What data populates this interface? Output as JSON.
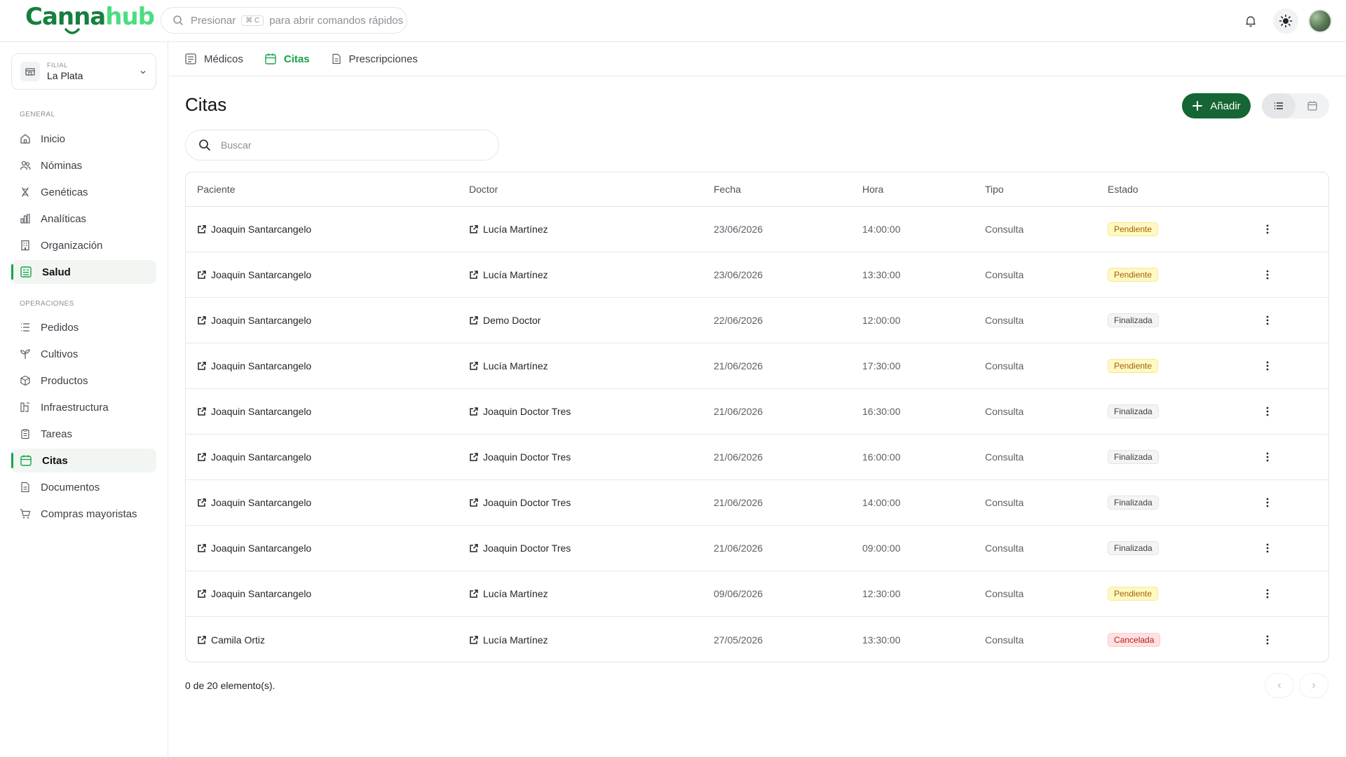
{
  "header": {
    "logo_part1": "Canna",
    "logo_part2": "hub",
    "command_prefix": "Presionar",
    "command_key": "⌘ C",
    "command_suffix": "para abrir comandos rápidos"
  },
  "sidebar": {
    "branch_caption": "FILIAL",
    "branch_name": "La Plata",
    "section_general": "GENERAL",
    "general_items": [
      {
        "label": "Inicio",
        "icon": "home-icon"
      },
      {
        "label": "Nóminas",
        "icon": "users-icon"
      },
      {
        "label": "Genéticas",
        "icon": "dna-icon"
      },
      {
        "label": "Analíticas",
        "icon": "chart-icon"
      },
      {
        "label": "Organización",
        "icon": "building-icon"
      },
      {
        "label": "Salud",
        "icon": "health-icon"
      }
    ],
    "section_operations": "OPERACIONES",
    "operation_items": [
      {
        "label": "Pedidos",
        "icon": "list-icon"
      },
      {
        "label": "Cultivos",
        "icon": "sprout-icon"
      },
      {
        "label": "Productos",
        "icon": "package-icon"
      },
      {
        "label": "Infraestructura",
        "icon": "infrastructure-icon"
      },
      {
        "label": "Tareas",
        "icon": "clipboard-icon"
      },
      {
        "label": "Citas",
        "icon": "calendar-icon"
      },
      {
        "label": "Documentos",
        "icon": "document-icon"
      },
      {
        "label": "Compras mayoristas",
        "icon": "cart-icon"
      }
    ]
  },
  "tabs": [
    {
      "label": "Médicos",
      "icon": "doctors-icon"
    },
    {
      "label": "Citas",
      "icon": "calendar-icon"
    },
    {
      "label": "Prescripciones",
      "icon": "document-icon"
    }
  ],
  "main": {
    "title": "Citas",
    "add_label": "Añadir",
    "search_placeholder": "Buscar",
    "footer_count": "0 de 20 elemento(s)."
  },
  "table": {
    "columns": [
      "Paciente",
      "Doctor",
      "Fecha",
      "Hora",
      "Tipo",
      "Estado"
    ],
    "rows": [
      {
        "patient": "Joaquin Santarcangelo",
        "doctor": "Lucía Martínez",
        "date": "23/06/2026",
        "time": "14:00:00",
        "type": "Consulta",
        "status": "Pendiente"
      },
      {
        "patient": "Joaquin Santarcangelo",
        "doctor": "Lucía Martínez",
        "date": "23/06/2026",
        "time": "13:30:00",
        "type": "Consulta",
        "status": "Pendiente"
      },
      {
        "patient": "Joaquin Santarcangelo",
        "doctor": "Demo Doctor",
        "date": "22/06/2026",
        "time": "12:00:00",
        "type": "Consulta",
        "status": "Finalizada"
      },
      {
        "patient": "Joaquin Santarcangelo",
        "doctor": "Lucía Martínez",
        "date": "21/06/2026",
        "time": "17:30:00",
        "type": "Consulta",
        "status": "Pendiente"
      },
      {
        "patient": "Joaquin Santarcangelo",
        "doctor": "Joaquin Doctor Tres",
        "date": "21/06/2026",
        "time": "16:30:00",
        "type": "Consulta",
        "status": "Finalizada"
      },
      {
        "patient": "Joaquin Santarcangelo",
        "doctor": "Joaquin Doctor Tres",
        "date": "21/06/2026",
        "time": "16:00:00",
        "type": "Consulta",
        "status": "Finalizada"
      },
      {
        "patient": "Joaquin Santarcangelo",
        "doctor": "Joaquin Doctor Tres",
        "date": "21/06/2026",
        "time": "14:00:00",
        "type": "Consulta",
        "status": "Finalizada"
      },
      {
        "patient": "Joaquin Santarcangelo",
        "doctor": "Joaquin Doctor Tres",
        "date": "21/06/2026",
        "time": "09:00:00",
        "type": "Consulta",
        "status": "Finalizada"
      },
      {
        "patient": "Joaquin Santarcangelo",
        "doctor": "Lucía Martínez",
        "date": "09/06/2026",
        "time": "12:30:00",
        "type": "Consulta",
        "status": "Pendiente"
      },
      {
        "patient": "Camila Ortiz",
        "doctor": "Lucía Martínez",
        "date": "27/05/2026",
        "time": "13:30:00",
        "type": "Consulta",
        "status": "Cancelada"
      }
    ]
  },
  "colors": {
    "accent": "#16a34a",
    "brand_dark": "#166534",
    "pending": "#fef9c3",
    "finished": "#f4f4f5",
    "cancelled": "#fee2e2"
  }
}
